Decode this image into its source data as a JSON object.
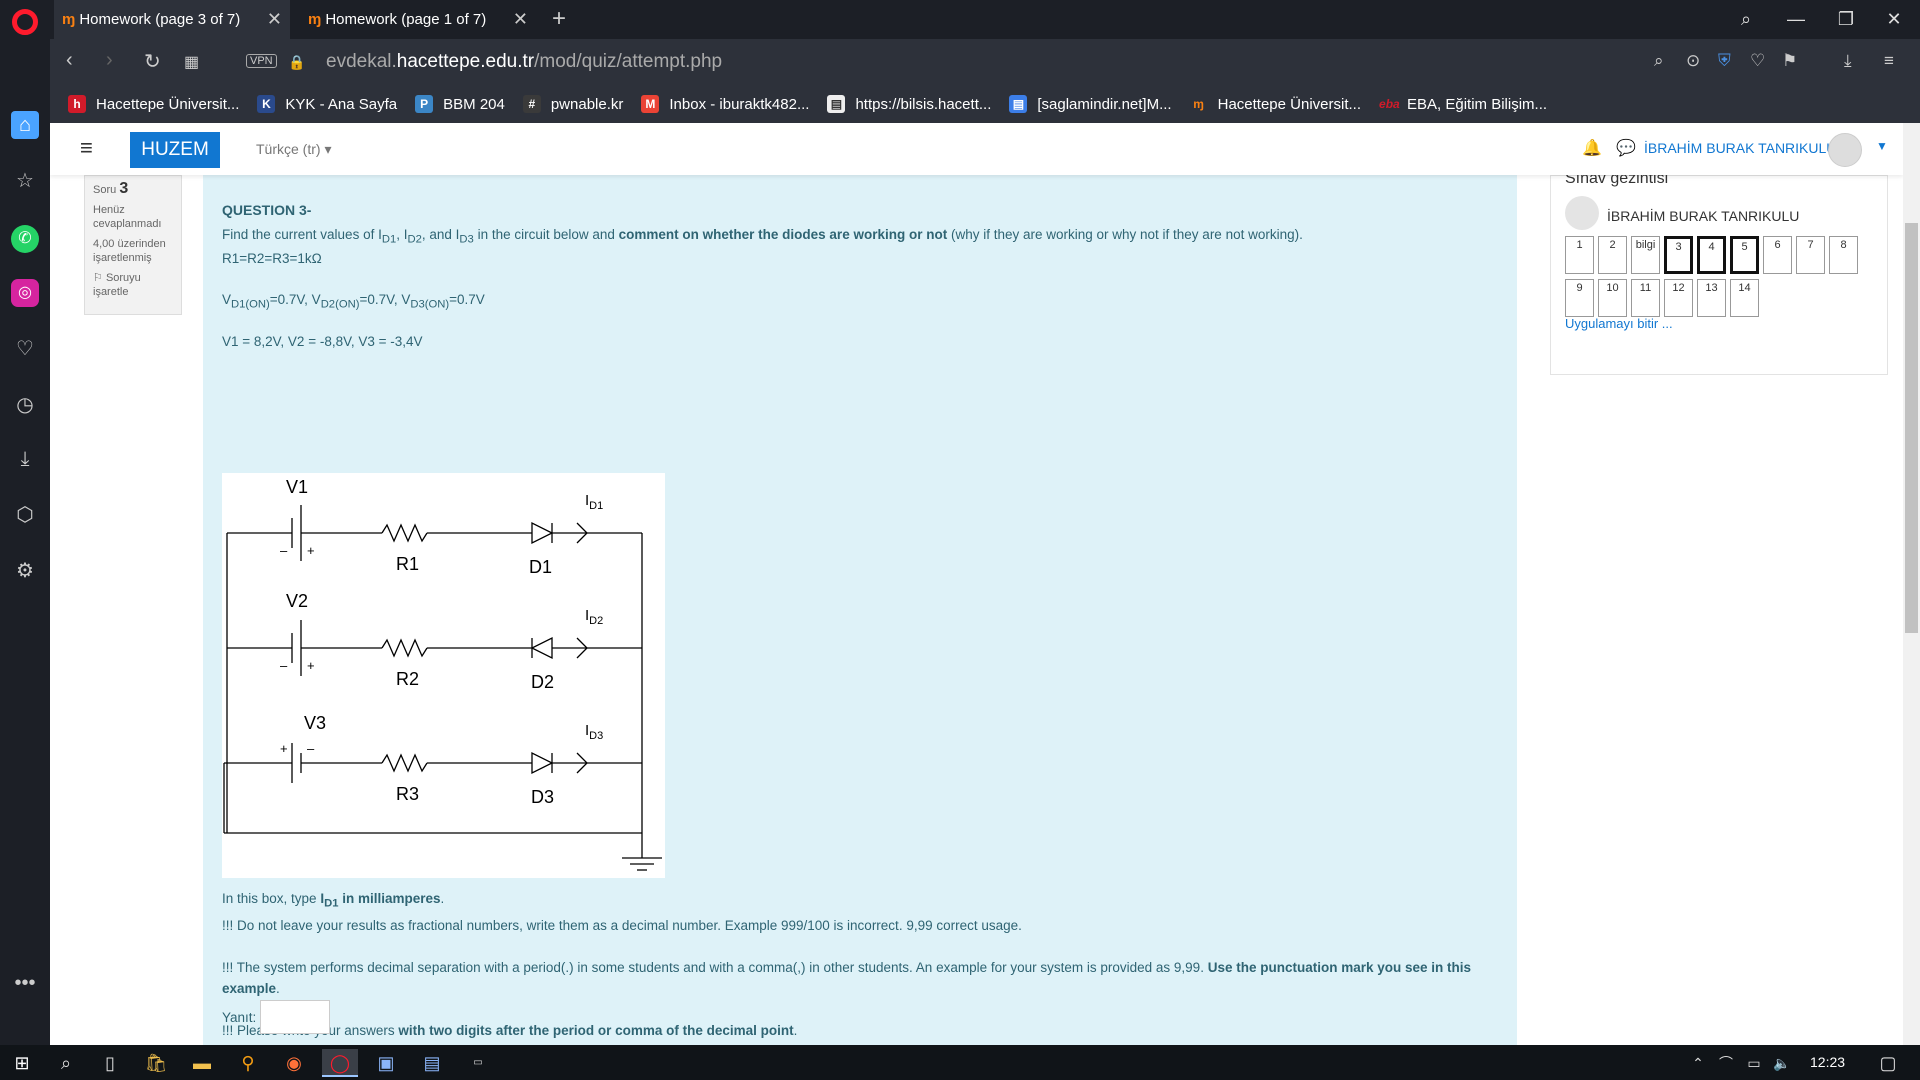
{
  "tabs": [
    {
      "icon": "moodle-icon",
      "title": "Homework (page 3 of 7)",
      "active": true
    },
    {
      "icon": "moodle-icon",
      "title": "Homework (page 1 of 7)",
      "active": false
    }
  ],
  "address": {
    "vpn_label": "VPN",
    "url_prefix": "evdekal.",
    "url_host": "hacettepe.edu.tr",
    "url_path": "/mod/quiz/attempt.php"
  },
  "bookmarks": [
    {
      "label": "Hacettepe Üniversit...",
      "icon": "hacettepe-icon",
      "color": "#d11b2a"
    },
    {
      "label": "KYK - Ana Sayfa",
      "icon": "kyk-icon",
      "color": "#2a4a8c"
    },
    {
      "label": "BBM 204",
      "icon": "piazza-icon",
      "color": "#3b86c6"
    },
    {
      "label": "pwnable.kr",
      "icon": "hash-icon",
      "color": "#3a3a3a"
    },
    {
      "label": "Inbox - iburaktk482...",
      "icon": "gmail-icon",
      "color": "#ea4335"
    },
    {
      "label": "https://bilsis.hacett...",
      "icon": "page-icon",
      "color": "#555555"
    },
    {
      "label": "[saglamindir.net]M...",
      "icon": "doc-icon",
      "color": "#3c7ee8"
    },
    {
      "label": "Hacettepe Üniversit...",
      "icon": "moodle-icon",
      "color": "#f98012"
    },
    {
      "label": "EBA, Eğitim Bilişim...",
      "icon": "eba-icon",
      "color": "#d11b2a"
    }
  ],
  "navbar": {
    "brand": "HUZEM",
    "language": "Türkçe (tr)",
    "user_name": "İBRAHİM BURAK TANRIKULU"
  },
  "question_info": {
    "label": "Soru",
    "number": "3",
    "status": "Henüz cevaplanmadı",
    "marks": "4,00 üzerinden işaretlenmiş",
    "flag": "Soruyu işaretle"
  },
  "question": {
    "title": "QUESTION 3-",
    "resistors": "R1=R2=R3=1kΩ",
    "voltages": "V1 = 8,2V, V2 = -8,8V, V3 = -3,4V",
    "answer_label": "Yanıt:",
    "answer_value": ""
  },
  "circuit": {
    "labels": [
      "V1",
      "V2",
      "V3",
      "R1",
      "R2",
      "R3",
      "D1",
      "D2",
      "D3",
      "ID1",
      "ID2",
      "ID3"
    ]
  },
  "quiz_nav": {
    "title": "Sınav gezintisi",
    "user": "İBRAHİM BURAK TANRIKULU",
    "buttons": [
      "1",
      "2",
      "bilgi",
      "3",
      "4",
      "5",
      "6",
      "7",
      "8",
      "9",
      "10",
      "11",
      "12",
      "13",
      "14"
    ],
    "current": [
      "3",
      "4",
      "5"
    ],
    "finish": "Uygulamayı bitir ..."
  },
  "taskbar": {
    "time": "12:23"
  }
}
